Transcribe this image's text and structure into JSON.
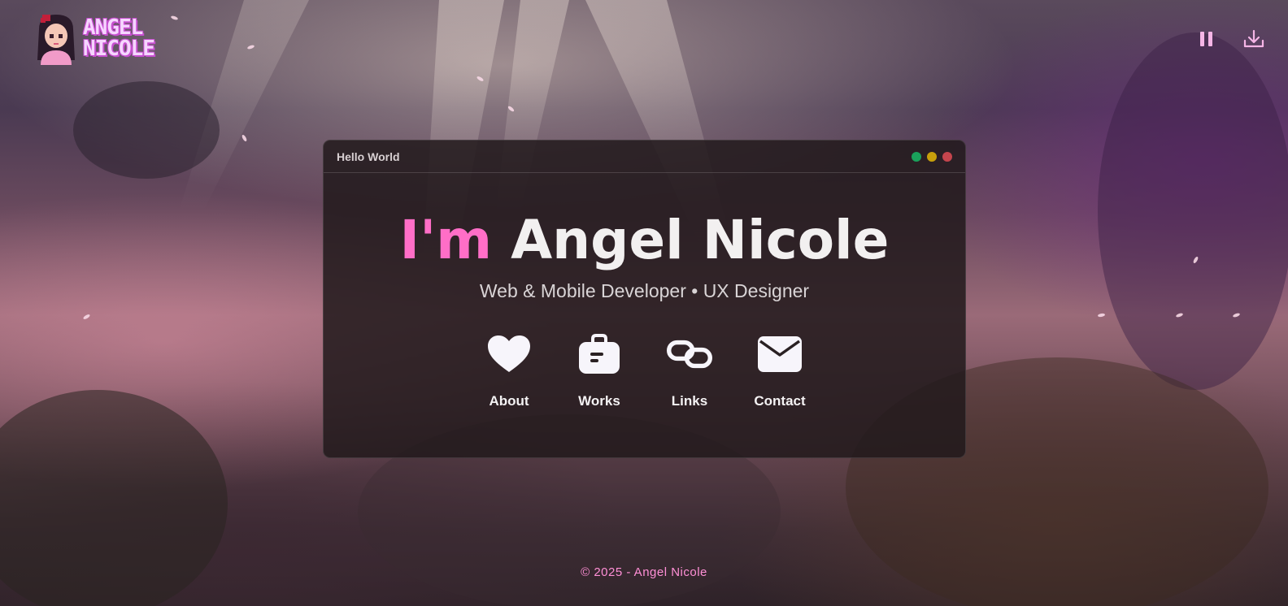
{
  "logo": {
    "line1": "ANGEL",
    "line2": "NICOLE"
  },
  "window": {
    "title": "Hello World",
    "dots": [
      "#1aa15b",
      "#c7a00b",
      "#c4454d"
    ]
  },
  "hero": {
    "prefix": "I'm",
    "name": "Angel Nicole",
    "subtitle": "Web & Mobile Developer • UX Designer"
  },
  "nav": [
    {
      "label": "About",
      "icon": "heart-icon"
    },
    {
      "label": "Works",
      "icon": "briefcase-icon"
    },
    {
      "label": "Links",
      "icon": "link-icon"
    },
    {
      "label": "Contact",
      "icon": "envelope-icon"
    }
  ],
  "controls": {
    "pause": "pause-icon",
    "download": "download-icon"
  },
  "footer": {
    "text": "© 2025 - Angel Nicole"
  },
  "colors": {
    "accent": "#ff6ec7",
    "footer": "#ff8fd6",
    "icon": "#f5b5e6"
  }
}
